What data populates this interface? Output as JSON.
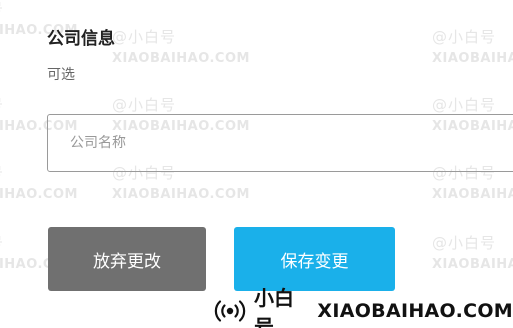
{
  "section": {
    "title": "公司信息",
    "subtitle": "可选"
  },
  "company_field": {
    "placeholder": "公司名称",
    "value": ""
  },
  "actions": {
    "discard_label": "放弃更改",
    "save_label": "保存变更"
  },
  "watermark": {
    "logo_text": "@小白号",
    "site_text": "XIAOBAIHAO.COM"
  },
  "brand": {
    "icon": "broadcast-icon",
    "name": "小白号",
    "site": "XIAOBAIHAO.COM"
  },
  "colors": {
    "save_button": "#1ab0ea",
    "discard_button": "#707070",
    "input_border": "#9a9a9a"
  }
}
